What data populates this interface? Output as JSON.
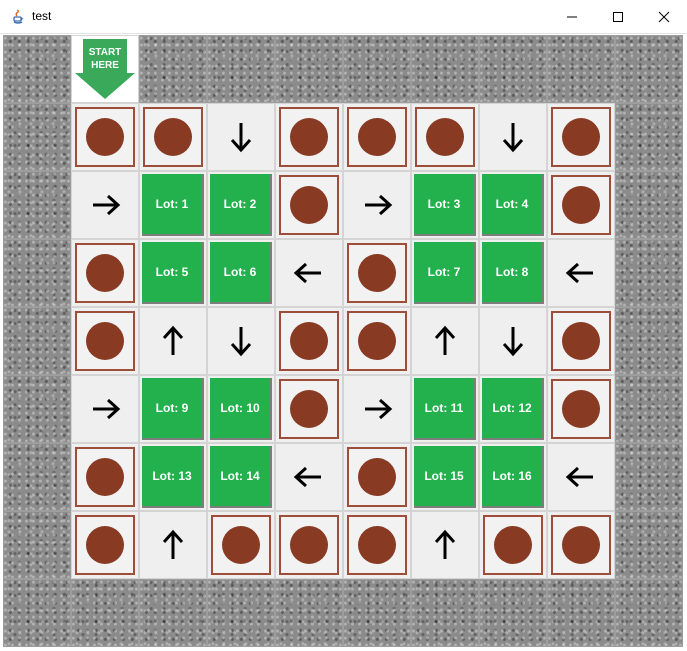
{
  "window": {
    "title": "test",
    "icon": "java-icon",
    "controls": [
      "minimize-icon",
      "maximize-icon",
      "close-icon"
    ]
  },
  "start_marker": {
    "line1": "START",
    "line2": "HERE",
    "color": "#3aaa5a"
  },
  "colors": {
    "lot": "#22b14c",
    "spot_ball": "#883a23",
    "spot_frame": "#9e4d3a",
    "road": "#efefef"
  },
  "legend_types": {
    "W": "stone-wall",
    "S": "start-marker",
    "O": "occupied-spot",
    "L": "parking-lot",
    "R": "arrow-right",
    "Lf": "arrow-left",
    "U": "arrow-up",
    "D": "arrow-down"
  },
  "grid": [
    [
      {
        "t": "W"
      },
      {
        "t": "S"
      },
      {
        "t": "W"
      },
      {
        "t": "W"
      },
      {
        "t": "W"
      },
      {
        "t": "W"
      },
      {
        "t": "W"
      },
      {
        "t": "W"
      },
      {
        "t": "W"
      },
      {
        "t": "W"
      }
    ],
    [
      {
        "t": "W"
      },
      {
        "t": "O"
      },
      {
        "t": "O"
      },
      {
        "t": "D"
      },
      {
        "t": "O"
      },
      {
        "t": "O"
      },
      {
        "t": "O"
      },
      {
        "t": "D"
      },
      {
        "t": "O"
      },
      {
        "t": "W"
      }
    ],
    [
      {
        "t": "W"
      },
      {
        "t": "R"
      },
      {
        "t": "L",
        "label": "Lot: 1"
      },
      {
        "t": "L",
        "label": "Lot: 2"
      },
      {
        "t": "O"
      },
      {
        "t": "R"
      },
      {
        "t": "L",
        "label": "Lot: 3"
      },
      {
        "t": "L",
        "label": "Lot: 4"
      },
      {
        "t": "O"
      },
      {
        "t": "W"
      }
    ],
    [
      {
        "t": "W"
      },
      {
        "t": "O"
      },
      {
        "t": "L",
        "label": "Lot: 5"
      },
      {
        "t": "L",
        "label": "Lot: 6"
      },
      {
        "t": "Lf"
      },
      {
        "t": "O"
      },
      {
        "t": "L",
        "label": "Lot: 7"
      },
      {
        "t": "L",
        "label": "Lot: 8"
      },
      {
        "t": "Lf"
      },
      {
        "t": "W"
      }
    ],
    [
      {
        "t": "W"
      },
      {
        "t": "O"
      },
      {
        "t": "U"
      },
      {
        "t": "D"
      },
      {
        "t": "O"
      },
      {
        "t": "O"
      },
      {
        "t": "U"
      },
      {
        "t": "D"
      },
      {
        "t": "O"
      },
      {
        "t": "W"
      }
    ],
    [
      {
        "t": "W"
      },
      {
        "t": "R"
      },
      {
        "t": "L",
        "label": "Lot: 9"
      },
      {
        "t": "L",
        "label": "Lot: 10"
      },
      {
        "t": "O"
      },
      {
        "t": "R"
      },
      {
        "t": "L",
        "label": "Lot: 11"
      },
      {
        "t": "L",
        "label": "Lot: 12"
      },
      {
        "t": "O"
      },
      {
        "t": "W"
      }
    ],
    [
      {
        "t": "W"
      },
      {
        "t": "O"
      },
      {
        "t": "L",
        "label": "Lot: 13"
      },
      {
        "t": "L",
        "label": "Lot: 14"
      },
      {
        "t": "Lf"
      },
      {
        "t": "O"
      },
      {
        "t": "L",
        "label": "Lot: 15"
      },
      {
        "t": "L",
        "label": "Lot: 16"
      },
      {
        "t": "Lf"
      },
      {
        "t": "W"
      }
    ],
    [
      {
        "t": "W"
      },
      {
        "t": "O"
      },
      {
        "t": "U"
      },
      {
        "t": "O"
      },
      {
        "t": "O"
      },
      {
        "t": "O"
      },
      {
        "t": "U"
      },
      {
        "t": "O"
      },
      {
        "t": "O"
      },
      {
        "t": "W"
      }
    ],
    [
      {
        "t": "W"
      },
      {
        "t": "W"
      },
      {
        "t": "W"
      },
      {
        "t": "W"
      },
      {
        "t": "W"
      },
      {
        "t": "W"
      },
      {
        "t": "W"
      },
      {
        "t": "W"
      },
      {
        "t": "W"
      },
      {
        "t": "W"
      }
    ]
  ]
}
